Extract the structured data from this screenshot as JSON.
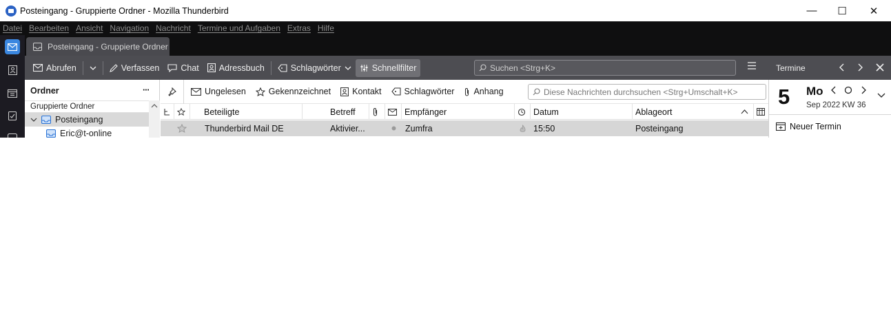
{
  "window": {
    "title": "Posteingang - Gruppierte Ordner - Mozilla Thunderbird",
    "controls": {
      "minimize": "—",
      "maximize": "☐",
      "close": "✕"
    }
  },
  "menu": [
    "Datei",
    "Bearbeiten",
    "Ansicht",
    "Navigation",
    "Nachricht",
    "Termine und Aufgaben",
    "Extras",
    "Hilfe"
  ],
  "tab": {
    "label": "Posteingang - Gruppierte Ordner"
  },
  "toolbar": {
    "get_messages": "Abrufen",
    "write": "Verfassen",
    "chat": "Chat",
    "address_book": "Adressbuch",
    "tags": "Schlagwörter",
    "quick_filter": "Schnellfilter",
    "search_placeholder": "Suchen <Strg+K>"
  },
  "folder_pane": {
    "title": "Ordner",
    "more": "···",
    "mode": "Gruppierte Ordner",
    "folders": [
      {
        "label": "Posteingang",
        "selected": true
      },
      {
        "label": "Eric@t-online",
        "selected": false
      }
    ]
  },
  "quick_filter": {
    "unread": "Ungelesen",
    "starred": "Gekennzeichnet",
    "contact": "Kontakt",
    "tags": "Schlagwörter",
    "attachment": "Anhang",
    "search_placeholder": "Diese Nachrichten durchsuchen <Strg+Umschalt+K>"
  },
  "columns": {
    "correspondents": "Beteiligte",
    "subject": "Betreff",
    "recipient": "Empfänger",
    "date": "Datum",
    "location": "Ablageort"
  },
  "messages": [
    {
      "correspondent": "Thunderbird Mail DE",
      "subject": "Aktivier...",
      "recipient": "Zumfra",
      "date": "15:50",
      "location": "Posteingang"
    }
  ],
  "calendar": {
    "title": "Termine",
    "day_number": "5",
    "day_name": "Mo",
    "month_year": "Sep 2022",
    "week": "KW 36",
    "new_event": "Neuer Termin"
  },
  "colors": {
    "accent": "#3b87e0",
    "toolbar_bg": "#4d4d52",
    "menubar_bg": "#0f0f10",
    "row_selected": "#d6d6d6"
  }
}
